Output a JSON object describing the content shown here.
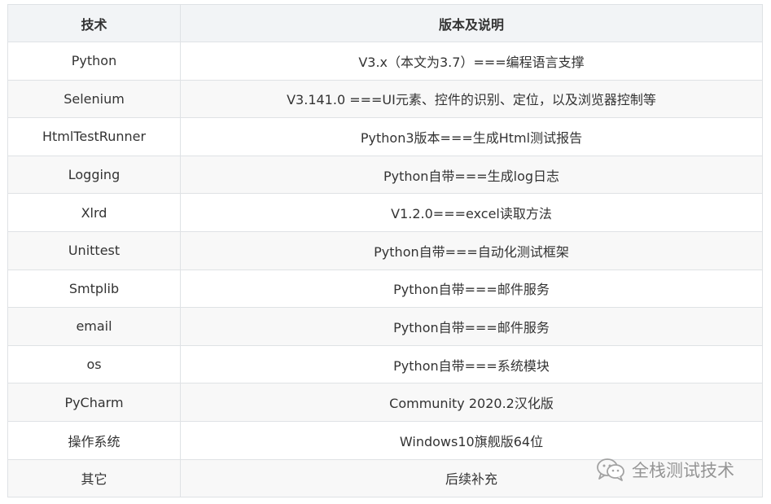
{
  "table": {
    "headers": [
      "技术",
      "版本及说明"
    ],
    "rows": [
      [
        "Python",
        "V3.x（本文为3.7）===编程语言支撑"
      ],
      [
        "Selenium",
        "V3.141.0 ===UI元素、控件的识别、定位，以及浏览器控制等"
      ],
      [
        "HtmlTestRunner",
        "Python3版本===生成Html测试报告"
      ],
      [
        "Logging",
        "Python自带===生成log日志"
      ],
      [
        "Xlrd",
        "V1.2.0===excel读取方法"
      ],
      [
        "Unittest",
        "Python自带===自动化测试框架"
      ],
      [
        "Smtplib",
        "Python自带===邮件服务"
      ],
      [
        "email",
        "Python自带===邮件服务"
      ],
      [
        "os",
        "Python自带===系统模块"
      ],
      [
        "PyCharm",
        "Community 2020.2汉化版"
      ],
      [
        "操作系统",
        "Windows10旗舰版64位"
      ],
      [
        "其它",
        "后续补充"
      ]
    ]
  },
  "watermark": {
    "icon": "wechat-icon",
    "text": "全栈测试技术"
  }
}
